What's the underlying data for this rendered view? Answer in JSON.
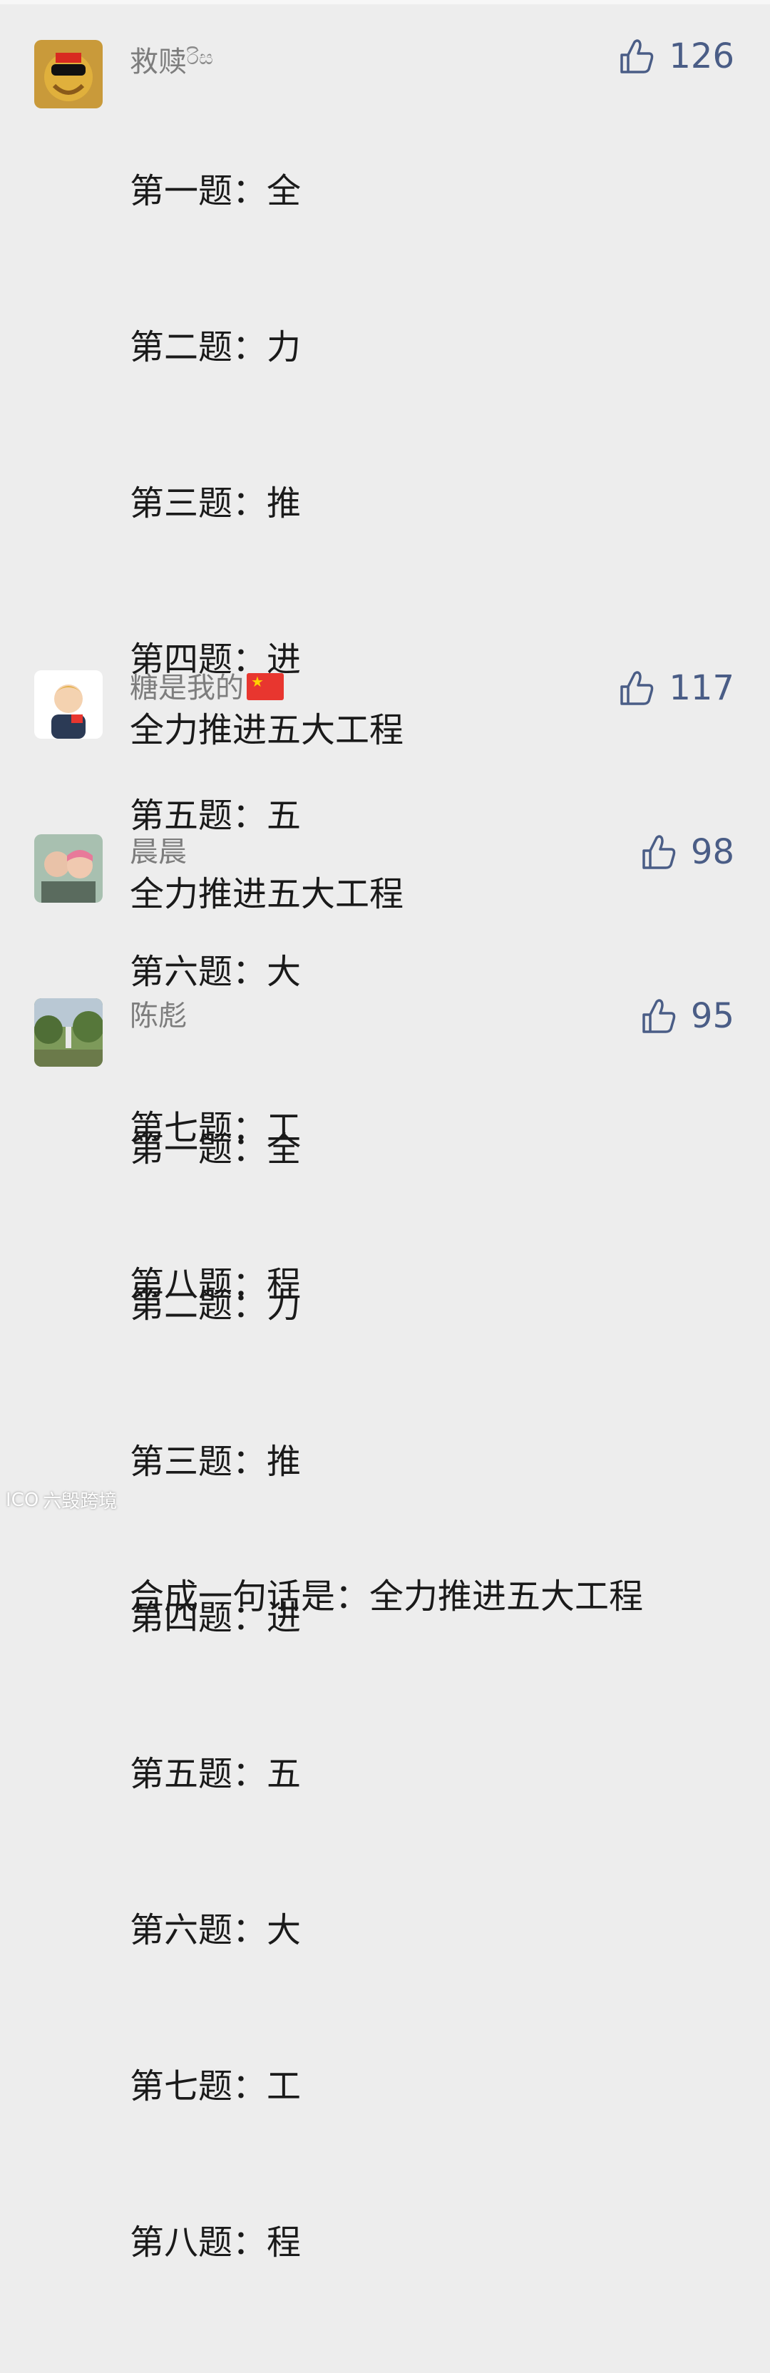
{
  "comments": [
    {
      "nickname": "救赎",
      "nick_suffix": "රිස",
      "likes": "126",
      "lines": [
        "第一题：全",
        "第二题：力",
        "第三题：推",
        "第四题：进",
        "第五题：五",
        "第六题：大",
        "第七题：工",
        "第八题：程"
      ],
      "summary": "合成一句话是：全力推进五大工程"
    },
    {
      "nickname": "糖是我的",
      "likes": "117",
      "text": "全力推进五大工程"
    },
    {
      "nickname": "晨晨",
      "likes": "98",
      "text": "全力推进五大工程"
    },
    {
      "nickname": "陈彪",
      "likes": "95",
      "lines": [
        "第一题：全",
        "第二题：力",
        "第三题：推",
        "第四题：进",
        "第五题：五",
        "第六题：大",
        "第七题：工",
        "第八题：程"
      ]
    }
  ],
  "watermark": {
    "logo": "ICO",
    "text": "六毁跨境"
  },
  "colors": {
    "like": "#4a5d86",
    "nickname": "#7d7d7d",
    "background": "#ededed"
  },
  "icons": {
    "like": "thumbs-up-icon"
  }
}
